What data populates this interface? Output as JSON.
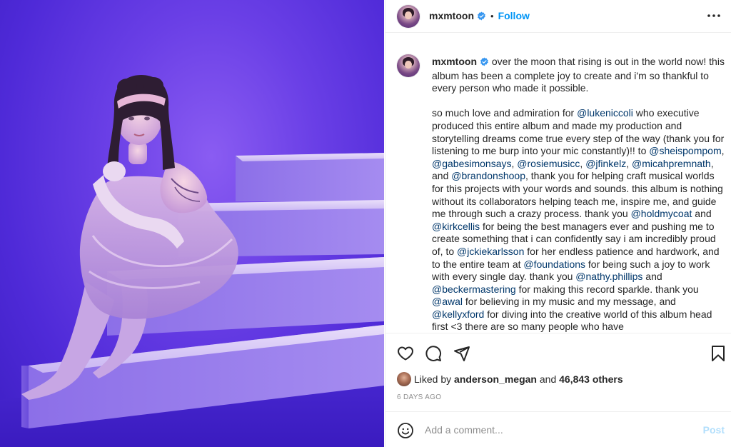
{
  "post": {
    "author": "mxmtoon",
    "follow_label": "Follow",
    "separator": "•",
    "caption": [
      {
        "t": "text",
        "v": "over the moon that rising is out in the world now! this album has been a complete joy to create and i'm so thankful to every person who made it possible.\n\nso much love and admiration for "
      },
      {
        "t": "link",
        "v": "@lukeniccoli"
      },
      {
        "t": "text",
        "v": " who executive produced this entire album and made my production and storytelling dreams come true every step of the way (thank you for listening to me burp into your mic constantly)!! to "
      },
      {
        "t": "link",
        "v": "@sheispompom"
      },
      {
        "t": "text",
        "v": ", "
      },
      {
        "t": "link",
        "v": "@gabesimonsays"
      },
      {
        "t": "text",
        "v": ", "
      },
      {
        "t": "link",
        "v": "@rosiemusicc"
      },
      {
        "t": "text",
        "v": ", "
      },
      {
        "t": "link",
        "v": "@jfinkelz"
      },
      {
        "t": "text",
        "v": ", "
      },
      {
        "t": "link",
        "v": "@micahpremnath"
      },
      {
        "t": "text",
        "v": ", and "
      },
      {
        "t": "link",
        "v": "@brandonshoop"
      },
      {
        "t": "text",
        "v": ", thank you for helping craft musical worlds for this projects with your words and sounds. this album is nothing without its collaborators helping teach me, inspire me, and guide me through such a crazy process. thank you "
      },
      {
        "t": "link",
        "v": "@holdmycoat"
      },
      {
        "t": "text",
        "v": " and "
      },
      {
        "t": "link",
        "v": "@kirkcellis"
      },
      {
        "t": "text",
        "v": " for being the best managers ever and pushing me to create something that i can confidently say i am incredibly proud of, to "
      },
      {
        "t": "link",
        "v": "@jckiekarlsson"
      },
      {
        "t": "text",
        "v": " for her endless patience and hardwork, and to the entire team at "
      },
      {
        "t": "link",
        "v": "@foundations"
      },
      {
        "t": "text",
        "v": " for being such a joy to work with every single day. thank you "
      },
      {
        "t": "link",
        "v": "@nathy.phillips"
      },
      {
        "t": "text",
        "v": " and "
      },
      {
        "t": "link",
        "v": "@beckermastering"
      },
      {
        "t": "text",
        "v": " for making this record sparkle. thank you "
      },
      {
        "t": "link",
        "v": "@awal"
      },
      {
        "t": "text",
        "v": " for believing in my music and my message, and "
      },
      {
        "t": "link",
        "v": "@kellyxford"
      },
      {
        "t": "text",
        "v": " for diving into the creative world of this album head first <3 there are so many people who have"
      }
    ],
    "likes": {
      "prefix": "Liked by",
      "user": "anderson_megan",
      "conjunction": "and",
      "count": "46,843 others"
    },
    "timestamp": "6 DAYS AGO"
  },
  "comment": {
    "placeholder": "Add a comment...",
    "post_label": "Post"
  },
  "icons": {
    "verified": "verified-badge-icon",
    "more": "more-options-icon",
    "like": "heart-icon",
    "comment": "comment-icon",
    "share": "share-icon",
    "save": "bookmark-icon",
    "emoji": "emoji-icon"
  },
  "colors": {
    "link": "#00376b",
    "follow": "#0095f6",
    "post_disabled": "#b2dffc",
    "verified": "#3897f0",
    "photo_background": "#5a33e0"
  }
}
